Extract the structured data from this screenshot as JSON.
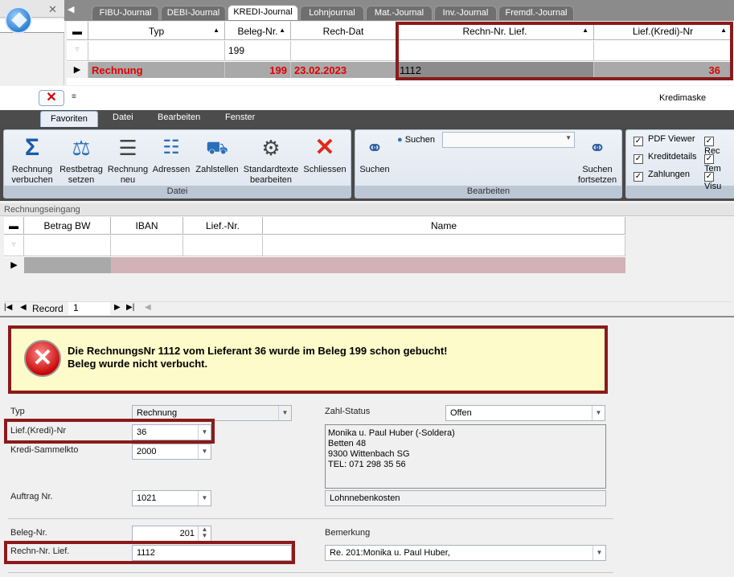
{
  "tabs": [
    "FIBU-Journal",
    "DEBI-Journal",
    "KREDI-Journal",
    "Lohnjournal",
    "Mat.-Journal",
    "Inv.-Journal",
    "Fremdl.-Journal"
  ],
  "top_grid": {
    "headers": [
      "Typ",
      "Beleg-Nr.",
      "Rech-Dat",
      "Rechn-Nr. Lief.",
      "Lief.(Kredi)-Nr"
    ],
    "filter_beleg": "199",
    "row": {
      "typ": "Rechnung",
      "beleg": "199",
      "datum": "23.02.2023",
      "rechn_nr": "1112",
      "lief_nr": "36"
    }
  },
  "app": {
    "title": "Kredimaske",
    "quick_more": "≡"
  },
  "ribbon_tabs": [
    "Favoriten",
    "Datei",
    "Bearbeiten",
    "Fenster"
  ],
  "ribbon": {
    "group_datei": "Datei",
    "group_bearbeiten": "Bearbeiten",
    "btn_verbuchen": "Rechnung verbuchen",
    "btn_restbetrag": "Restbetrag setzen",
    "btn_neu": "Rechnung neu",
    "btn_adressen": "Adressen",
    "btn_zahlstellen": "Zahlstellen",
    "btn_standardtexte": "Standardtexte bearbeiten",
    "btn_schliessen": "Schliessen",
    "btn_suchen": "Suchen",
    "btn_suchen_fortsetzen": "Suchen fortsetzen",
    "search_label": "Suchen",
    "chk_pdf": "PDF Viewer",
    "chk_kredidetails": "Kreditdetails",
    "chk_zahlungen": "Zahlungen",
    "chk_rec": "Rec",
    "chk_tem": "Tem",
    "chk_visu": "Visu"
  },
  "rechnungseingang": {
    "title": "Rechnungseingang",
    "headers": [
      "Betrag BW",
      "IBAN",
      "Lief.-Nr.",
      "Name"
    ]
  },
  "navbar": {
    "record_label": "Record",
    "record_value": "1"
  },
  "error": {
    "line1": "Die RechnungsNr 1112 vom Lieferant 36 wurde im Beleg 199 schon gebucht!",
    "line2": "Beleg wurde nicht verbucht."
  },
  "form": {
    "typ_label": "Typ",
    "typ_value": "Rechnung",
    "lief_label": "Lief.(Kredi)-Nr",
    "lief_value": "36",
    "sammelkto_label": "Kredi-Sammelkto",
    "sammelkto_value": "2000",
    "auftrag_label": "Auftrag Nr.",
    "auftrag_value": "1021",
    "beleg_label": "Beleg-Nr.",
    "beleg_value": "201",
    "rechn_label": "Rechn-Nr. Lief.",
    "rechn_value": "1112",
    "zahlstatus_label": "Zahl-Status",
    "zahlstatus_value": "Offen",
    "address_lines": [
      "Monika u. Paul Huber (-Soldera)",
      "Betten 48",
      "9300 Wittenbach SG",
      "TEL: 071 298 35 56"
    ],
    "konto_value": "Lohnnebenkosten",
    "bemerkung_label": "Bemerkung",
    "bemerkung_value": "Re. 201:Monika u. Paul Huber,"
  },
  "colors": {
    "highlight": "#8b1a1a",
    "error_bg": "#fdfbc9",
    "red_text": "#e00000"
  }
}
